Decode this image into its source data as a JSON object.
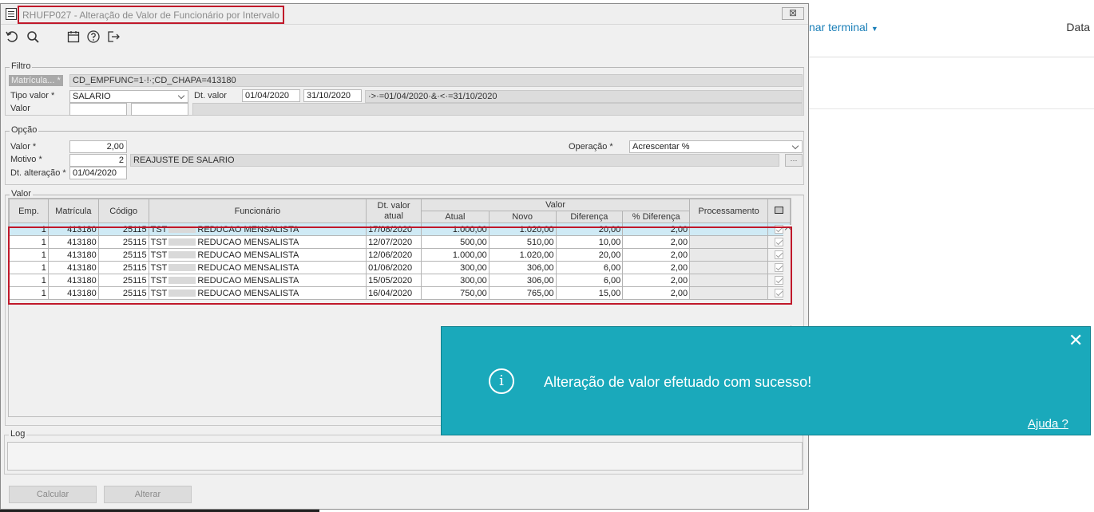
{
  "background": {
    "terminal_link": "nar terminal",
    "data_label": "Data"
  },
  "window": {
    "title": "RHUFP027 - Alteração de Valor de Funcionário por Intervalo",
    "close_glyph": "⊠"
  },
  "toolbar": {
    "icons": [
      "undo-icon",
      "search-icon",
      "calendar-icon",
      "help-icon",
      "exit-icon"
    ]
  },
  "filtro": {
    "legend": "Filtro",
    "matricula_label": "Matrícula... *",
    "matricula_value": "CD_EMPFUNC=1·!·;CD_CHAPA=413180",
    "tipo_valor_label": "Tipo valor *",
    "tipo_valor_value": "SALARIO",
    "dt_valor_label": "Dt. valor",
    "dt_inicio": "01/04/2020",
    "dt_fim": "31/10/2020",
    "dt_expr": "·>·=01/04/2020·&·<·=31/10/2020",
    "valor_label": "Valor"
  },
  "opcao": {
    "legend": "Opção",
    "valor_label": "Valor *",
    "valor_value": "2,00",
    "operacao_label": "Operação *",
    "operacao_value": "Acrescentar %",
    "motivo_label": "Motivo *",
    "motivo_code": "2",
    "motivo_desc": "REAJUSTE DE SALARIO",
    "dt_alteracao_label": "Dt. alteração *",
    "dt_alteracao_value": "01/04/2020"
  },
  "valor_section": {
    "legend": "Valor",
    "headers": {
      "emp": "Emp.",
      "matricula": "Matrícula",
      "codigo": "Código",
      "funcionario": "Funcionário",
      "dt_valor": "Dt. valor atual",
      "valor_group": "Valor",
      "atual": "Atual",
      "novo": "Novo",
      "diferenca": "Diferença",
      "pct_diferenca": "% Diferença",
      "processamento": "Processamento"
    },
    "rows": [
      {
        "emp": "1",
        "matricula": "413180",
        "codigo": "25115",
        "func_prefix": "TST",
        "func_suffix": "REDUCAO MENSALISTA",
        "dt": "17/08/2020",
        "atual": "1.000,00",
        "novo": "1.020,00",
        "dif": "20,00",
        "pct": "2,00"
      },
      {
        "emp": "1",
        "matricula": "413180",
        "codigo": "25115",
        "func_prefix": "TST",
        "func_suffix": "REDUCAO MENSALISTA",
        "dt": "12/07/2020",
        "atual": "500,00",
        "novo": "510,00",
        "dif": "10,00",
        "pct": "2,00"
      },
      {
        "emp": "1",
        "matricula": "413180",
        "codigo": "25115",
        "func_prefix": "TST",
        "func_suffix": "REDUCAO MENSALISTA",
        "dt": "12/06/2020",
        "atual": "1.000,00",
        "novo": "1.020,00",
        "dif": "20,00",
        "pct": "2,00"
      },
      {
        "emp": "1",
        "matricula": "413180",
        "codigo": "25115",
        "func_prefix": "TST",
        "func_suffix": "REDUCAO MENSALISTA",
        "dt": "01/06/2020",
        "atual": "300,00",
        "novo": "306,00",
        "dif": "6,00",
        "pct": "2,00"
      },
      {
        "emp": "1",
        "matricula": "413180",
        "codigo": "25115",
        "func_prefix": "TST",
        "func_suffix": "REDUCAO MENSALISTA",
        "dt": "15/05/2020",
        "atual": "300,00",
        "novo": "306,00",
        "dif": "6,00",
        "pct": "2,00"
      },
      {
        "emp": "1",
        "matricula": "413180",
        "codigo": "25115",
        "func_prefix": "TST",
        "func_suffix": "REDUCAO MENSALISTA",
        "dt": "16/04/2020",
        "atual": "750,00",
        "novo": "765,00",
        "dif": "15,00",
        "pct": "2,00"
      }
    ]
  },
  "log": {
    "legend": "Log"
  },
  "buttons": {
    "calcular": "Calcular",
    "alterar": "Alterar"
  },
  "toast": {
    "message": "Alteração de valor efetuado com sucesso!",
    "help": "Ajuda ?",
    "info_glyph": "i",
    "close_glyph": "✕"
  }
}
